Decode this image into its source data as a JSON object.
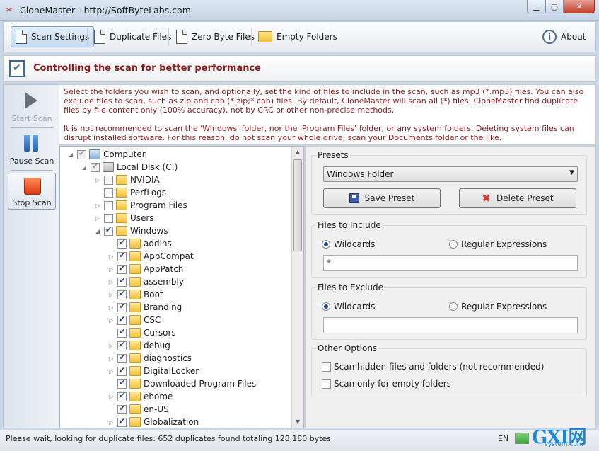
{
  "window": {
    "title": "CloneMaster - http://SoftByteLabs.com"
  },
  "toolbar": {
    "scan_settings": "Scan Settings",
    "duplicate_files": "Duplicate Files",
    "zero_byte_files": "Zero Byte Files",
    "empty_folders": "Empty Folders",
    "about": "About"
  },
  "header": {
    "title": "Controlling the scan for better performance"
  },
  "actions": {
    "start": "Start Scan",
    "pause": "Pause Scan",
    "stop": "Stop Scan"
  },
  "info": {
    "p1": "Select the folders you wish to scan, and optionally, set the kind of files to include in the scan, such as mp3 (*.mp3) files. You can also exclude files to scan, such as zip and cab (*.zip;*.cab) files. By default, CloneMaster will scan all (*) files. CloneMaster find duplicate files by file content only (100% accuracy), not by CRC or other non-precise methods.",
    "p2": "It is not recommended to scan the 'Windows' folder, nor the 'Program Files' folder, or any system folders. Deleting system files can disrupt installed software. For this reason, do not scan your whole drive, scan your Documents folder or the like."
  },
  "tree": [
    {
      "label": "Computer",
      "level": 0,
      "twisty": "▼",
      "checked": true,
      "grey": true,
      "icon": "computer-icon"
    },
    {
      "label": "Local Disk (C:)",
      "level": 1,
      "twisty": "▲",
      "checked": true,
      "grey": true,
      "icon": "drive-icon"
    },
    {
      "label": "NVIDIA",
      "level": 2,
      "twisty": "▷",
      "checked": false
    },
    {
      "label": "PerfLogs",
      "level": 2,
      "twisty": "",
      "checked": false
    },
    {
      "label": "Program Files",
      "level": 2,
      "twisty": "▷",
      "checked": false
    },
    {
      "label": "Users",
      "level": 2,
      "twisty": "▷",
      "checked": false
    },
    {
      "label": "Windows",
      "level": 2,
      "twisty": "◢",
      "checked": true
    },
    {
      "label": "addins",
      "level": 3,
      "twisty": "",
      "checked": true
    },
    {
      "label": "AppCompat",
      "level": 3,
      "twisty": "▷",
      "checked": true
    },
    {
      "label": "AppPatch",
      "level": 3,
      "twisty": "▷",
      "checked": true
    },
    {
      "label": "assembly",
      "level": 3,
      "twisty": "▷",
      "checked": true
    },
    {
      "label": "Boot",
      "level": 3,
      "twisty": "▷",
      "checked": true
    },
    {
      "label": "Branding",
      "level": 3,
      "twisty": "▷",
      "checked": true
    },
    {
      "label": "CSC",
      "level": 3,
      "twisty": "▷",
      "checked": true
    },
    {
      "label": "Cursors",
      "level": 3,
      "twisty": "",
      "checked": true
    },
    {
      "label": "debug",
      "level": 3,
      "twisty": "▷",
      "checked": true
    },
    {
      "label": "diagnostics",
      "level": 3,
      "twisty": "▷",
      "checked": true
    },
    {
      "label": "DigitalLocker",
      "level": 3,
      "twisty": "▷",
      "checked": true
    },
    {
      "label": "Downloaded Program Files",
      "level": 3,
      "twisty": "",
      "checked": true
    },
    {
      "label": "ehome",
      "level": 3,
      "twisty": "▷",
      "checked": true
    },
    {
      "label": "en-US",
      "level": 3,
      "twisty": "",
      "checked": true
    },
    {
      "label": "Globalization",
      "level": 3,
      "twisty": "▷",
      "checked": true
    }
  ],
  "presets": {
    "title": "Presets",
    "selected": "Windows Folder",
    "save": "Save Preset",
    "delete": "Delete Preset"
  },
  "include": {
    "title": "Files to Include",
    "wildcards": "Wildcards",
    "regex": "Regular Expressions",
    "value": "*"
  },
  "exclude": {
    "title": "Files to Exclude",
    "wildcards": "Wildcards",
    "regex": "Regular Expressions",
    "value": ""
  },
  "other": {
    "title": "Other Options",
    "hidden": "Scan hidden files and folders (not recommended)",
    "empty": "Scan only for empty folders"
  },
  "status": {
    "message": "Please wait, looking for duplicate files:  652 duplicates found totaling 128,180 bytes",
    "lang": "EN"
  },
  "watermark": {
    "big": "GXI网",
    "small": "system.com"
  }
}
